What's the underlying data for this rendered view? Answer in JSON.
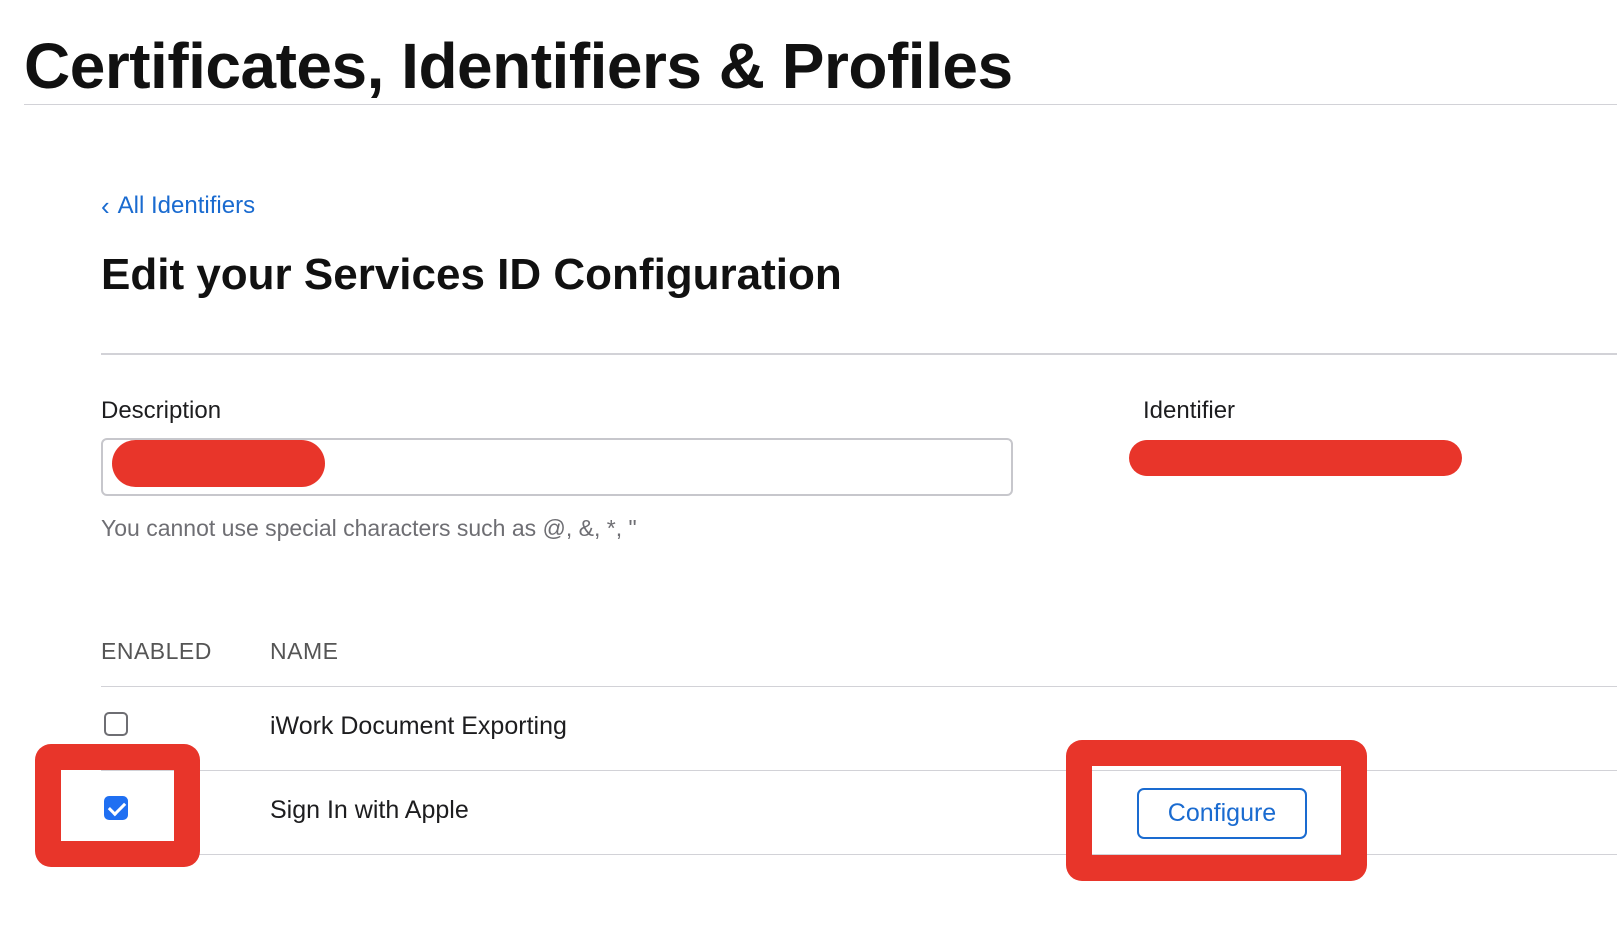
{
  "header": {
    "title": "Certificates, Identifiers & Profiles"
  },
  "breadcrumb": {
    "back_label": "All Identifiers",
    "back_icon": "chevron-left-icon"
  },
  "section": {
    "title": "Edit your Services ID Configuration"
  },
  "form": {
    "description_label": "Description",
    "description_value": "",
    "identifier_label": "Identifier",
    "help_text": "You cannot use special characters such as @, &, *, \""
  },
  "capabilities": {
    "columns": {
      "enabled": "ENABLED",
      "name": "NAME"
    },
    "rows": [
      {
        "name": "iWork Document Exporting",
        "enabled": false
      },
      {
        "name": "Sign In with Apple",
        "enabled": true,
        "action_label": "Configure"
      }
    ]
  },
  "colors": {
    "accent": "#1a6bd0",
    "checkbox": "#1f6ff2",
    "annotation": "#e8352a"
  }
}
